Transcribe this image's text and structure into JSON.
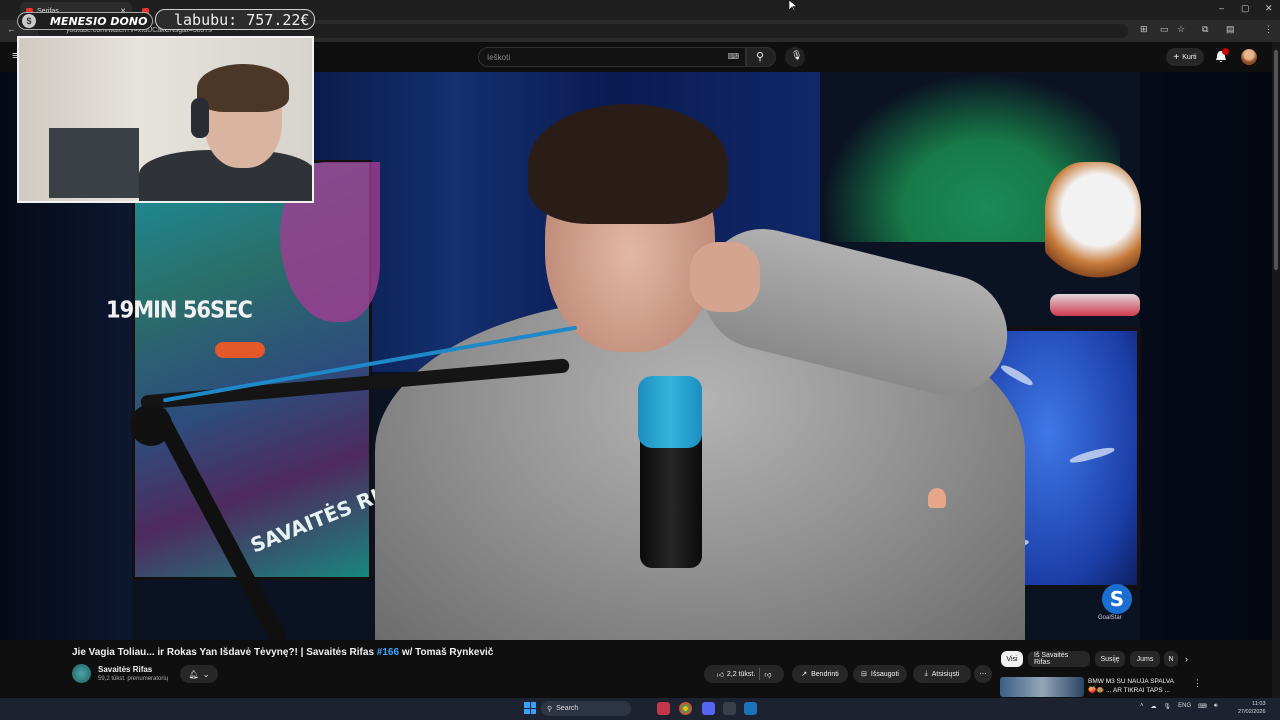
{
  "browser": {
    "tab_title": "Serifas",
    "url": "youtube.com/watch?v=xfdUCakCNsg&t=5897s",
    "window_controls": [
      "–",
      "▢",
      "✕"
    ]
  },
  "youtube": {
    "search_placeholder": "Ieškoti",
    "create_label": "Kurti",
    "notification_count": "9+"
  },
  "stream_overlay": {
    "donor_label": "MENESIO DONO",
    "donor_coin": "$",
    "donation_text": "labubu: 757.22€"
  },
  "video": {
    "timer_text": "19MIN 56SEC",
    "poster_text": "SAVAITĖS RIFAS",
    "watermark_letter": "S",
    "watermark_sub": "GoalStar",
    "title_text": "Jie Vagia Toliau... ir Rokas Yan Išdavė Tėvynę?! | Savaitės Rifas ",
    "title_hashtag": "#166",
    "title_suffix": " w/ Tomaš Rynkevič"
  },
  "channel": {
    "name": "Savaitės Rifas",
    "subscribers": "59,2 tūkst. prenumeratorių"
  },
  "actions": {
    "like_count": "2,2 tūkst.",
    "share_label": "Bendrinti",
    "save_label": "Išsaugoti",
    "download_label": "Atsisiųsti",
    "more": "⋯"
  },
  "chips": [
    "Visi",
    "Iš Savaitės Rifas",
    "Susiję",
    "Jums",
    "N"
  ],
  "recommendation": {
    "title_line1": "BMW M3 SU NAUJA SPALVA",
    "title_line2": "🍑🐵 ... AR TIKRAI TAPS ..."
  },
  "taskbar": {
    "search_label": "Search",
    "language": "ENG",
    "time": "11:03",
    "date": "27/02/2026"
  },
  "colors": {
    "accent_link": "#3ea6ff",
    "notification_red": "#cc0000",
    "windows_blue": "#3aa0ff"
  }
}
